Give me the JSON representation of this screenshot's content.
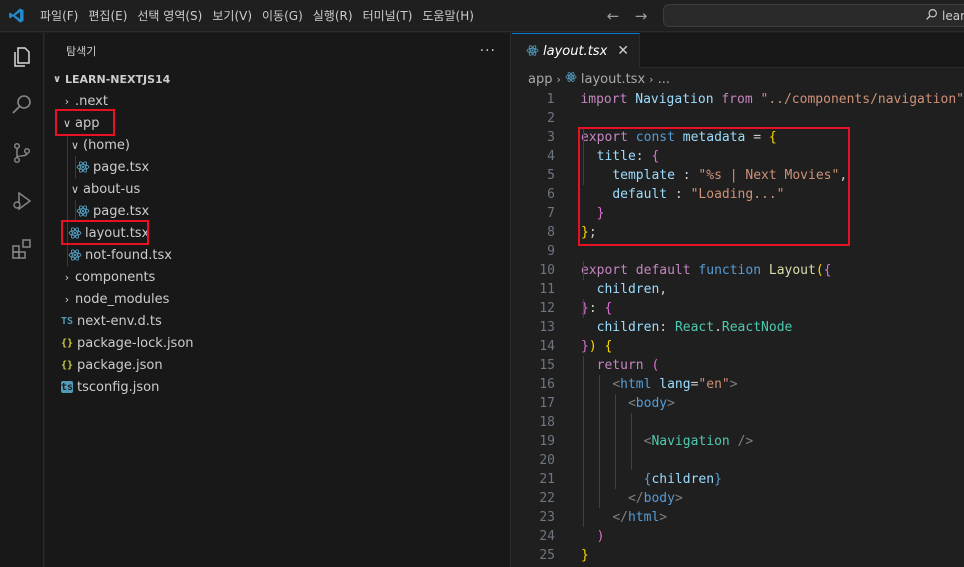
{
  "titlebar": {
    "menu": [
      "파일(F)",
      "편집(E)",
      "선택 영역(S)",
      "보기(V)",
      "이동(G)",
      "실행(R)",
      "터미널(T)",
      "도움말(H)"
    ],
    "search_text": "learn"
  },
  "sidebar": {
    "title": "탐색기",
    "more": "···",
    "project": "LEARN-NEXTJS14",
    "items": [
      {
        "label": ".next",
        "type": "folder",
        "expanded": false
      },
      {
        "label": "app",
        "type": "folder",
        "expanded": true
      },
      {
        "label": "(home)",
        "type": "folder",
        "expanded": true
      },
      {
        "label": "page.tsx",
        "type": "react"
      },
      {
        "label": "about-us",
        "type": "folder",
        "expanded": true
      },
      {
        "label": "page.tsx",
        "type": "react"
      },
      {
        "label": "layout.tsx",
        "type": "react"
      },
      {
        "label": "not-found.tsx",
        "type": "react"
      },
      {
        "label": "components",
        "type": "folder",
        "expanded": false
      },
      {
        "label": "node_modules",
        "type": "folder",
        "expanded": false
      },
      {
        "label": "next-env.d.ts",
        "type": "ts"
      },
      {
        "label": "package-lock.json",
        "type": "json"
      },
      {
        "label": "package.json",
        "type": "json"
      },
      {
        "label": "tsconfig.json",
        "type": "tsconfig"
      }
    ],
    "icons": {
      "ts": "TS",
      "json": "{}",
      "tsconfig": "ts"
    }
  },
  "editor": {
    "tab_label": "layout.tsx",
    "breadcrumb": [
      "app",
      "layout.tsx",
      "..."
    ],
    "line_numbers": [
      "1",
      "2",
      "3",
      "4",
      "5",
      "6",
      "7",
      "8",
      "9",
      "10",
      "11",
      "12",
      "13",
      "14",
      "15",
      "16",
      "17",
      "18",
      "19",
      "20",
      "21",
      "22",
      "23",
      "24",
      "25"
    ]
  },
  "colors": {
    "accent": "#0078d4",
    "highlight_box": "#e81123",
    "keyword": "#569cd6",
    "string": "#ce9178",
    "variable": "#9cdcfe"
  }
}
